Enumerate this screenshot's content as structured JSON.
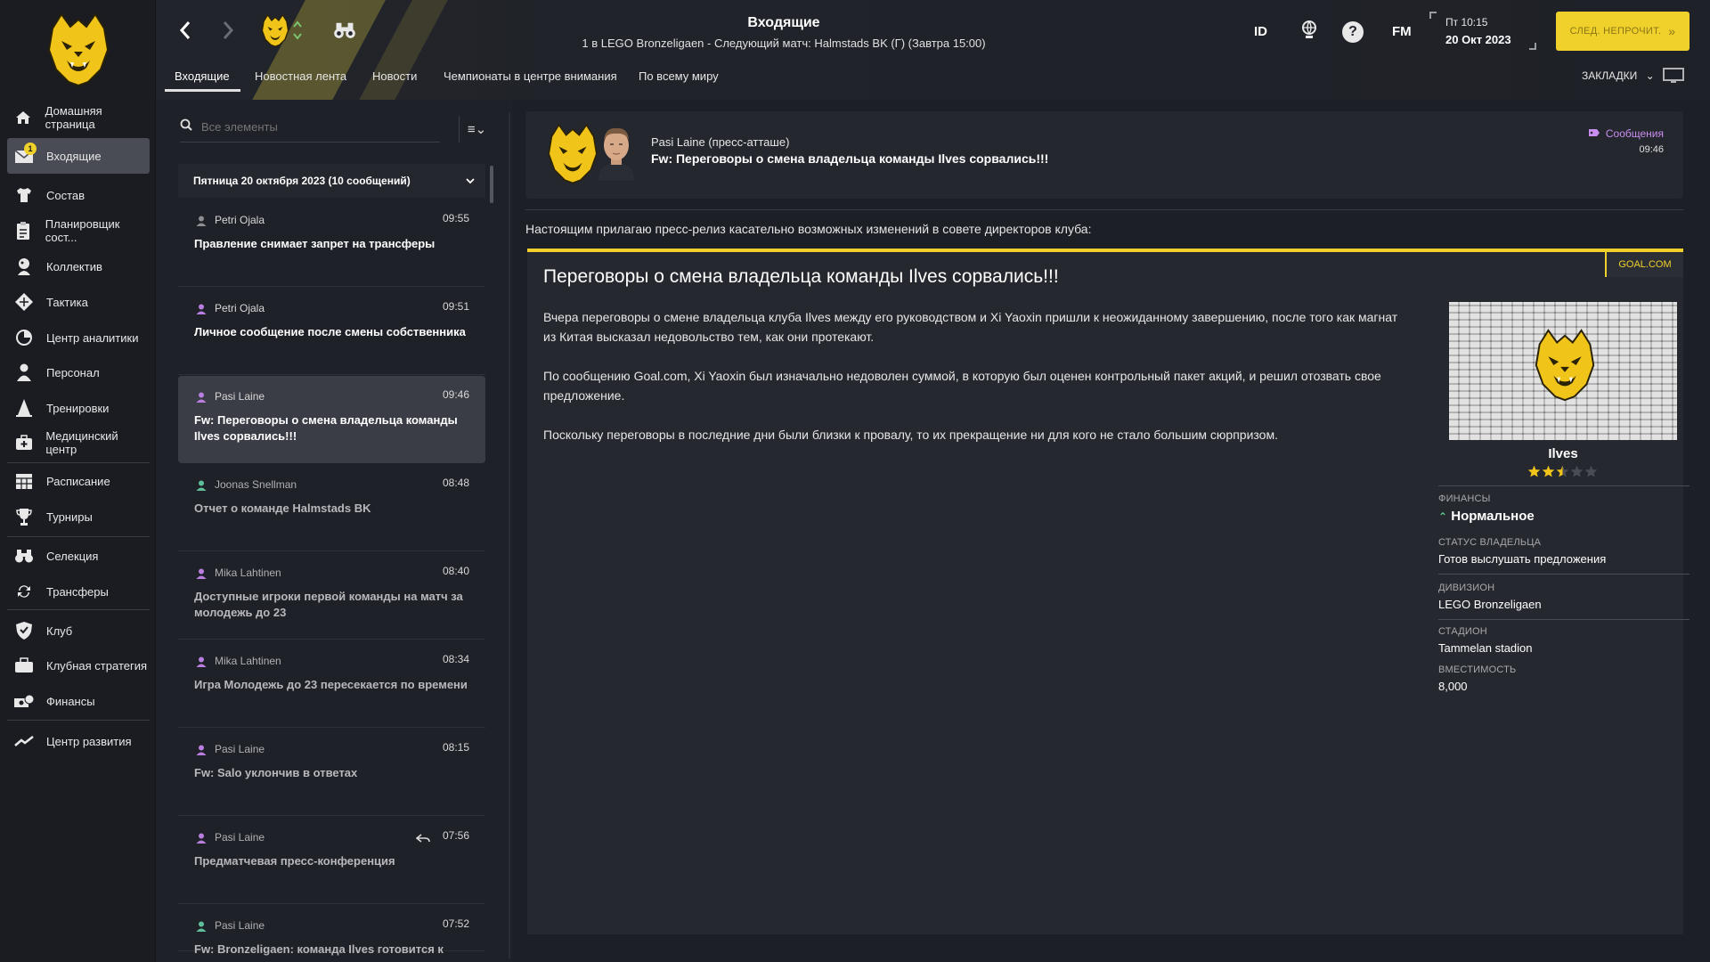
{
  "header": {
    "title": "Входящие",
    "subtitle": "1 в LEGO Bronzeligaen - Следующий матч: Halmstads BK (Г) (Завтра 15:00)",
    "tabs": [
      "Входящие",
      "Новостная лента",
      "Новости",
      "Чемпионаты в центре внимания",
      "По всему миру"
    ],
    "id_label": "ID",
    "fm_label": "FM",
    "clock_time": "Пт 10:15",
    "clock_date": "20 Окт 2023",
    "next_button": "СЛЕД. НЕПРОЧИТ.",
    "bookmarks": "ЗАКЛАДКИ"
  },
  "sidebar": {
    "items": [
      {
        "label": "Домашняя страница",
        "icon": "home-icon"
      },
      {
        "label": "Входящие",
        "icon": "inbox-icon",
        "badge": "1"
      },
      {
        "label": "Состав",
        "icon": "shirt-icon"
      },
      {
        "label": "Планировщик сост...",
        "icon": "clipboard-icon"
      },
      {
        "label": "Коллектив",
        "icon": "users-icon"
      },
      {
        "label": "Тактика",
        "icon": "tactics-icon"
      },
      {
        "label": "Центр аналитики",
        "icon": "analytics-icon"
      },
      {
        "label": "Персонал",
        "icon": "staff-icon"
      },
      {
        "label": "Тренировки",
        "icon": "cone-icon"
      },
      {
        "label": "Медицинский центр",
        "icon": "medical-icon"
      },
      {
        "label": "Расписание",
        "icon": "calendar-icon"
      },
      {
        "label": "Турниры",
        "icon": "trophy-icon"
      },
      {
        "label": "Селекция",
        "icon": "binoculars-icon"
      },
      {
        "label": "Трансферы",
        "icon": "transfer-icon"
      },
      {
        "label": "Клуб",
        "icon": "shield-icon"
      },
      {
        "label": "Клубная стратегия",
        "icon": "briefcase-icon"
      },
      {
        "label": "Финансы",
        "icon": "money-icon"
      },
      {
        "label": "Центр развития",
        "icon": "development-icon"
      }
    ]
  },
  "inbox": {
    "search_placeholder": "Все элементы",
    "group_header": "Пятница 20 октября 2023 (10 сообщений)",
    "messages": [
      {
        "sender": "Petri Ojala",
        "time": "09:55",
        "subject": "Правление снимает запрет на трансферы",
        "person_color": "#8d8d94"
      },
      {
        "sender": "Petri Ojala",
        "time": "09:51",
        "subject": "Личное сообщение после смены собственника",
        "person_color": "#b97ee0"
      },
      {
        "sender": "Pasi Laine",
        "time": "09:46",
        "subject": "Fw: Переговоры о смена владельца команды Ilves сорвались!!!",
        "person_color": "#b97ee0"
      },
      {
        "sender": "Joonas Snellman",
        "time": "08:48",
        "subject": "Отчет о команде Halmstads BK",
        "person_color": "#5fbf9a"
      },
      {
        "sender": "Mika Lahtinen",
        "time": "08:40",
        "subject": "Доступные игроки первой команды на матч за молодежь до 23",
        "person_color": "#b97ee0"
      },
      {
        "sender": "Mika Lahtinen",
        "time": "08:34",
        "subject": "Игра Молодежь до 23 пересекается по времени",
        "person_color": "#b97ee0"
      },
      {
        "sender": "Pasi Laine",
        "time": "08:15",
        "subject": "Fw: Salo уклончив в ответах",
        "person_color": "#b97ee0"
      },
      {
        "sender": "Pasi Laine",
        "time": "07:56",
        "subject": "Предматчевая пресс-конференция",
        "person_color": "#b97ee0"
      },
      {
        "sender": "Pasi Laine",
        "time": "07:52",
        "subject": "Fw: Bronzeligaen: команда Ilves готовится к",
        "person_color": "#5fbf9a"
      }
    ]
  },
  "detail": {
    "from": "Pasi Laine  (пресс-атташе)",
    "subject": "Fw: Переговоры о смена владельца команды Ilves сорвались!!!",
    "tag": "Сообщения",
    "time": "09:46",
    "intro": "Настоящим прилагаю пресс-релиз касательно возможных изменений в совете директоров клуба:",
    "article": {
      "source": "GOAL.COM",
      "title": "Переговоры о смена владельца команды Ilves сорвались!!!",
      "paragraphs": [
        "Вчера переговоры о смене владельца клуба Ilves между его руководством и Xi Yaoxin пришли к неожиданному завершению, после того как магнат из Китая высказал недовольство тем, как они протекают.",
        "По сообщению Goal.com, Xi Yaoxin был изначально недоволен суммой, в которую был оценен контрольный пакет акций, и решил отозвать свое предложение.",
        "Поскольку переговоры в последние дни были близки к провалу, то их прекращение ни для кого не стало большим сюрпризом."
      ]
    },
    "club": {
      "name": "Ilves",
      "stars": 2.5,
      "finances_label": "ФИНАНСЫ",
      "finances_value": "Нормальное",
      "owner_label": "СТАТУС ВЛАДЕЛЬЦА",
      "owner_value": "Готов выслушать предложения",
      "division_label": "ДИВИЗИОН",
      "division_value": "LEGO Bronzeligaen",
      "stadium_label": "СТАДИОН",
      "stadium_value": "Tammelan stadion",
      "capacity_label": "ВМЕСТИМОСТЬ",
      "capacity_value": "8,000"
    }
  },
  "colors": {
    "accent": "#f0d12c",
    "bg": "#1d1f26",
    "panel": "#25272e",
    "sidebar_active": "#4a4c55",
    "purple_tag": "#c98ef0",
    "green_up": "#5fd08a"
  }
}
